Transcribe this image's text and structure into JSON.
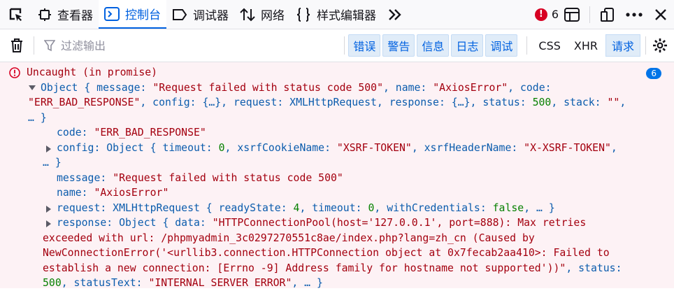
{
  "toolbar": {
    "inspector": "查看器",
    "console": "控制台",
    "debugger": "调试器",
    "network": "网络",
    "style_editor": "样式编辑器",
    "error_count": "6"
  },
  "filterbar": {
    "placeholder": "过滤输出",
    "levels": [
      "错误",
      "警告",
      "信息",
      "日志",
      "调试"
    ],
    "types": [
      "CSS",
      "XHR",
      "请求"
    ]
  },
  "log": {
    "header": "Uncaught (in promise)",
    "repeat_count": "6",
    "summary": {
      "l1_a": "Object { message: ",
      "msg": "\"Request failed with status code 500\"",
      "l1_b": ", name: ",
      "name": "\"AxiosError\"",
      "l1_c": ", code:",
      "code": "\"ERR_BAD_RESPONSE\"",
      "l2_a": ", config: {…}, request: XMLHttpRequest, response: {…}, status: ",
      "status": "500",
      "l2_b": ", stack: ",
      "stack": "\"\"",
      "l2_c": ",",
      "l3": "… }"
    },
    "code_row": {
      "key": "code: ",
      "value": "\"ERR_BAD_RESPONSE\""
    },
    "config_row": {
      "a": "config: Object { timeout: ",
      "timeout": "0",
      "b": ", xsrfCookieName: ",
      "cookie": "\"XSRF-TOKEN\"",
      "c": ", xsrfHeaderName: ",
      "header": "\"X-XSRF-TOKEN\"",
      "d": ",",
      "cont": "… }"
    },
    "message_row": {
      "key": "message: ",
      "value": "\"Request failed with status code 500\""
    },
    "name_row": {
      "key": "name: ",
      "value": "\"AxiosError\""
    },
    "request_row": {
      "a": "request: XMLHttpRequest { readyState: ",
      "ready": "4",
      "b": ", timeout: ",
      "timeout": "0",
      "c": ", withCredentials: ",
      "cred": "false",
      "d": ", … }"
    },
    "response_row": {
      "a": "response: Object { data: ",
      "data_l1": "\"HTTPConnectionPool(host='127.0.0.1', port=888): Max retries",
      "data_l2": "exceeded with url: /phpmyadmin_3c0297270551c8ae/index.php?lang=zh_cn (Caused by",
      "data_l3": "NewConnectionError('<urllib3.connection.HTTPConnection object at 0x7fecab2aa410>: Failed to",
      "data_l4": "establish a new connection: [Errno -9] Address family for hostname not supported'))\"",
      "b": ", status:",
      "status": "500",
      "c": ", statusText: ",
      "status_text": "\"INTERNAL SERVER ERROR\"",
      "d": ", … }"
    }
  }
}
